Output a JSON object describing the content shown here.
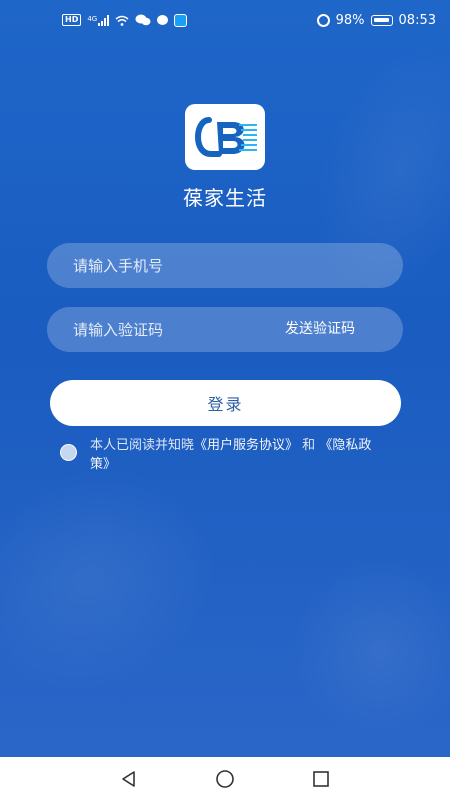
{
  "status_bar": {
    "hd_label": "HD",
    "network_label": "4G",
    "battery_percent": "98%",
    "time": "08:53",
    "icons": [
      "hd-icon",
      "signal-icon",
      "wifi-icon",
      "wechat-icon",
      "message-icon",
      "app-notification-icon",
      "alarm-icon",
      "battery-icon"
    ]
  },
  "app": {
    "title": "葆家生活",
    "logo_icon": "app-logo-icon",
    "accent_color": "#1f66c9"
  },
  "form": {
    "phone_placeholder": "请输入手机号",
    "phone_value": "",
    "code_placeholder": "请输入验证码",
    "code_value": "",
    "send_code_label": "发送验证码",
    "login_label": "登录"
  },
  "agreement": {
    "checked": false,
    "prefix": "本人已阅读并知晓",
    "user_agreement": "《用户服务协议》",
    "conjunction": "和",
    "privacy_policy": "《隐私政策》"
  },
  "nav_bar": {
    "icons": [
      "back-icon",
      "home-icon",
      "recents-icon"
    ]
  }
}
